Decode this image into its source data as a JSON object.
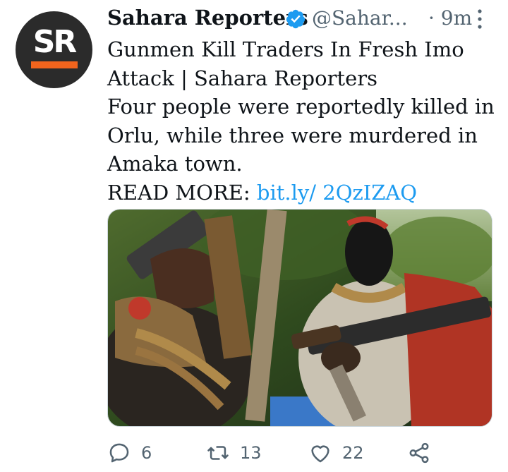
{
  "tweet": {
    "avatar_text": "SR",
    "author_name": "Sahara Reporters",
    "handle": "@Sahar...",
    "time": "· 9m",
    "lines": [
      "Gunmen Kill Traders In Fresh Imo",
      "Attack | Sahara Reporters",
      "Four people were reportedly killed in",
      "Orlu, while three were murdered in",
      "Amaka town."
    ],
    "read_more_label": "READ MORE: ",
    "link_text": "bit.ly/ 2QzIZAQ",
    "media_icon": "photo-gunmen-with-rifles",
    "actions": {
      "replies": "6",
      "retweets": "13",
      "likes": "22"
    },
    "colors": {
      "link": "#1d9bf0",
      "verified": "#1d9bf0",
      "brand_orange": "#f2641d",
      "secondary_text": "#536471"
    }
  }
}
